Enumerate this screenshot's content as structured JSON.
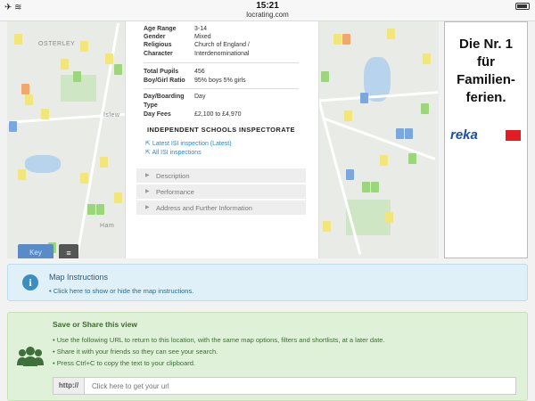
{
  "status_bar": {
    "time": "15:21",
    "url": "locrating.com"
  },
  "map": {
    "labels": [
      "OSTERLEY",
      "Islew",
      "Ham"
    ],
    "key_label": "Key"
  },
  "school_info": {
    "rows": [
      {
        "label": "Age Range",
        "value": "3-14"
      },
      {
        "label": "Gender",
        "value": "Mixed"
      },
      {
        "label": "Religious Character",
        "value": "Church of England / Interdenominational"
      },
      {
        "label": "Total Pupils",
        "value": "456"
      },
      {
        "label": "Boy/Girl Ratio",
        "value": "95% boys 5% girls"
      },
      {
        "label": "Day/Boarding Type",
        "value": "Day"
      },
      {
        "label": "Day Fees",
        "value": "£2,100 to £4,970"
      }
    ],
    "isi_heading": "INDEPENDENT SCHOOLS INSPECTORATE",
    "isi_links": [
      "Latest ISI inspection (Latest)",
      "All ISI inspections"
    ],
    "accordions": [
      "Description",
      "Performance",
      "Address and Further Information"
    ]
  },
  "ad": {
    "lines": [
      "Die Nr. 1",
      "für",
      "Familien-",
      "ferien."
    ],
    "brand": "reka",
    "colors": {
      "brand": "#1a4fa3",
      "flag": "#e31b23"
    }
  },
  "instructions": {
    "title": "Map Instructions",
    "item": "Click here to show or hide the map instructions."
  },
  "share": {
    "title": "Save or Share this view",
    "items": [
      "Use the following URL to return to this location, with the same map options, filters and shortlists, at a later date.",
      "Share it with your friends so they can see your search.",
      "Press Ctrl+C to copy the text to your clipboard."
    ],
    "url_prefix": "http://",
    "url_placeholder": "Click here to get your url"
  },
  "colors": {
    "instructions_bg": "#dff0f8",
    "share_bg": "#dff1d8",
    "link": "#2a8bbf"
  }
}
